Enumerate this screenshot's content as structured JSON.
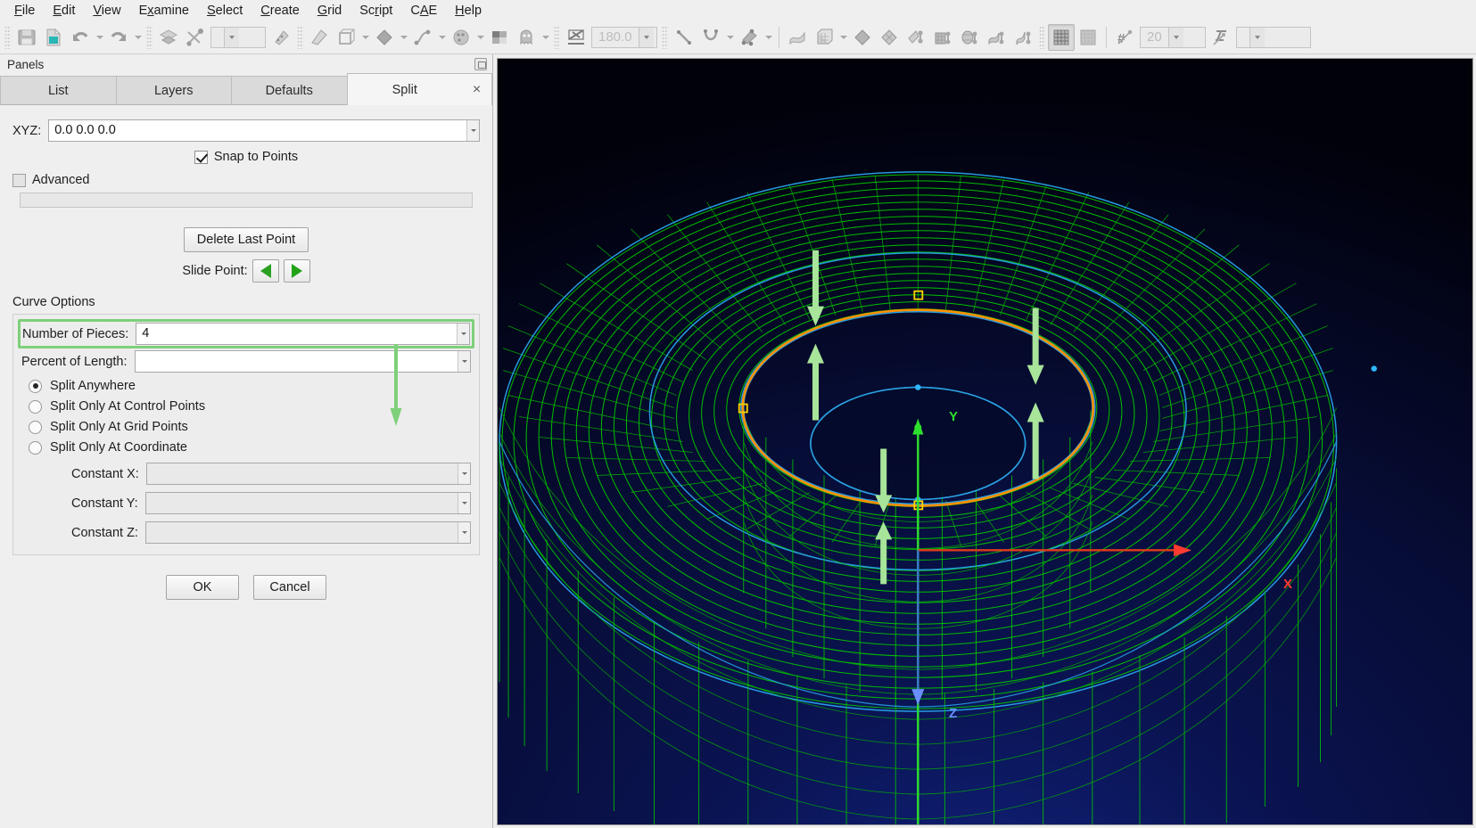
{
  "menubar": {
    "items": [
      {
        "label": "File",
        "mnemonic_index": 0
      },
      {
        "label": "Edit",
        "mnemonic_index": 0
      },
      {
        "label": "View",
        "mnemonic_index": 0
      },
      {
        "label": "Examine",
        "mnemonic_index": 1
      },
      {
        "label": "Select",
        "mnemonic_index": 0
      },
      {
        "label": "Create",
        "mnemonic_index": 0
      },
      {
        "label": "Grid",
        "mnemonic_index": 0
      },
      {
        "label": "Script",
        "mnemonic_index": 3
      },
      {
        "label": "CAE",
        "mnemonic_index": 1
      },
      {
        "label": "Help",
        "mnemonic_index": 0
      }
    ]
  },
  "toolbar": {
    "icons": [
      "save-icon",
      "new-file-icon",
      "undo-icon",
      "redo-icon",
      "select-layer-icon",
      "connector-tool-icon",
      "entity-type-combo",
      "texture-icon",
      "paint-icon",
      "box-view-icon",
      "shape-icon",
      "curve-tool-icon",
      "palette-icon",
      "render-mode-icon",
      "ghost-icon",
      "angle-tool-icon",
      "angle-value-field",
      "line-icon",
      "curve-icon",
      "point-cloud-icon",
      "surface-icon",
      "block-icon",
      "quad-icon",
      "diamond-icon",
      "extrude-icon",
      "structured-block-icon",
      "ellipse-block-icon",
      "solver-icon",
      "grid-on-icon",
      "grid-off-icon",
      "dimension-icon",
      "dimension-value-field",
      "attribute-icon",
      "attribute-value-field"
    ],
    "angle_value": "180.0",
    "dimension_value": "20",
    "attribute_value": "",
    "entity_combo_value": ""
  },
  "panel": {
    "title": "Panels",
    "float_button": "float-panel-icon",
    "tabs": [
      {
        "label": "List",
        "active": false
      },
      {
        "label": "Layers",
        "active": false
      },
      {
        "label": "Defaults",
        "active": false
      },
      {
        "label": "Split",
        "active": true
      }
    ],
    "close_label": "×",
    "xyz": {
      "label": "XYZ:",
      "value": "0.0 0.0 0.0"
    },
    "snap_to_points": {
      "label": "Snap to Points",
      "checked": true
    },
    "advanced": {
      "label": "Advanced",
      "checked": false
    },
    "delete_last_point_label": "Delete Last Point",
    "slide_point": {
      "label": "Slide Point:",
      "prev_icon": "left-triangle-icon",
      "next_icon": "right-triangle-icon"
    },
    "curve_options": {
      "title": "Curve Options",
      "number_of_pieces": {
        "label": "Number of Pieces:",
        "value": "4",
        "highlighted": true,
        "highlight_color": "#7ed07a"
      },
      "percent_of_length": {
        "label": "Percent of Length:",
        "value": ""
      },
      "modes": [
        {
          "label": "Split Anywhere",
          "selected": true
        },
        {
          "label": "Split Only At Control Points",
          "selected": false
        },
        {
          "label": "Split Only At Grid Points",
          "selected": false
        },
        {
          "label": "Split Only At Coordinate",
          "selected": false
        }
      ],
      "constants": [
        {
          "label": "Constant X:",
          "value": ""
        },
        {
          "label": "Constant Y:",
          "value": ""
        },
        {
          "label": "Constant Z:",
          "value": ""
        }
      ]
    },
    "ok_label": "OK",
    "cancel_label": "Cancel",
    "annotation_arrow": {
      "name": "green-pointer-arrow",
      "color": "#7ed07a",
      "points_to": "Number of Pieces:"
    }
  },
  "viewport": {
    "background_top": "#0a1350",
    "background_bottom": "#01010a",
    "mesh_color": "#00d000",
    "edge_color": "#2a9fe0",
    "selection_color": "#ff9000",
    "marker_color": "#ffd400",
    "annotation_color": "#a8e49a",
    "axes": [
      {
        "label": "X",
        "color": "#ff3b30"
      },
      {
        "label": "Y",
        "color": "#2ee02e"
      },
      {
        "label": "Z",
        "color": "#6a8fff"
      }
    ],
    "selected_entity": "orange-circle-connector",
    "annotation_arrows": 6,
    "model": "torus-cylinder-wireframe-mesh"
  }
}
